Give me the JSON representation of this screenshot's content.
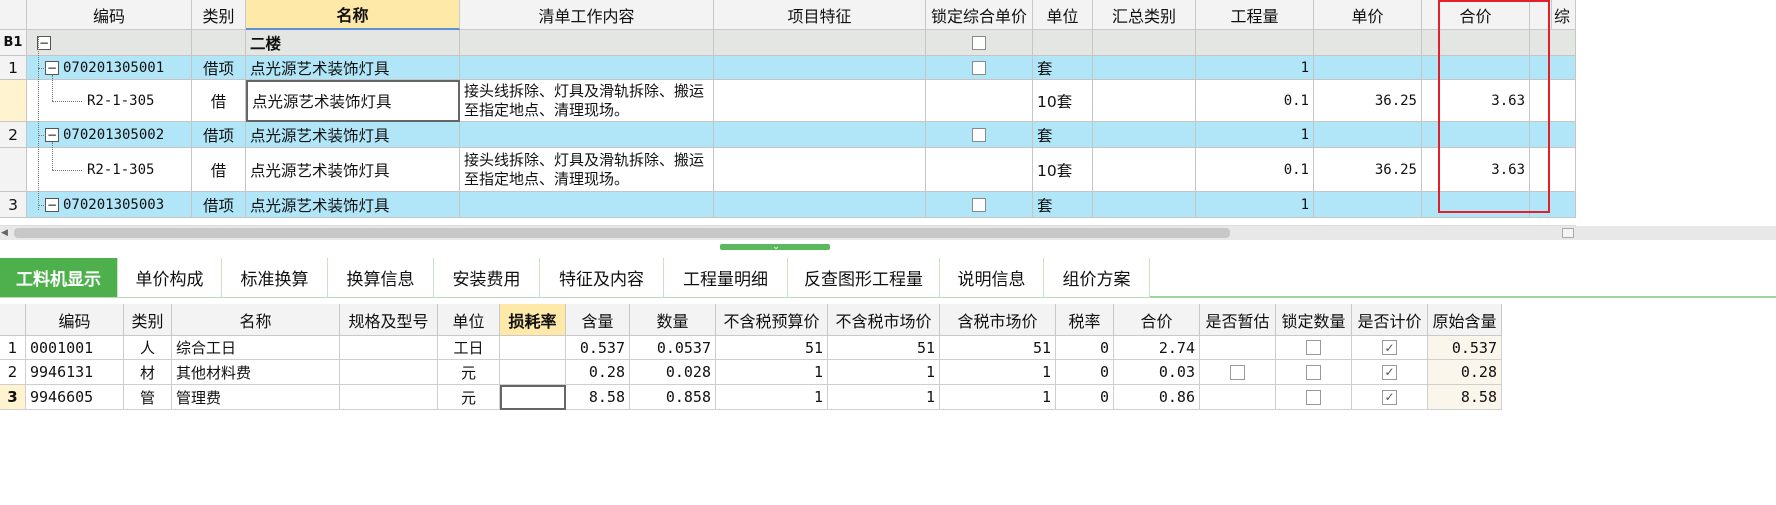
{
  "top_headers": [
    "编码",
    "类别",
    "名称",
    "清单工作内容",
    "项目特征",
    "锁定综合单价",
    "单位",
    "汇总类别",
    "工程量",
    "单价",
    "合价",
    "综"
  ],
  "top_rows": [
    {
      "num": "B1",
      "code": "",
      "type": "",
      "name": "二楼",
      "content": "",
      "feature": "",
      "unit": "",
      "qty": "",
      "price": "",
      "total": ""
    },
    {
      "num": "1",
      "code": "070201305001",
      "type": "借项",
      "name": "点光源艺术装饰灯具",
      "content": "",
      "feature": "",
      "unit": "套",
      "qty": "1",
      "price": "",
      "total": ""
    },
    {
      "num": "",
      "code": "R2-1-305",
      "type": "借",
      "name": "点光源艺术装饰灯具",
      "content": "接头线拆除、灯具及滑轨拆除、搬运至指定地点、清理现场。",
      "feature": "",
      "unit": "10套",
      "qty": "0.1",
      "price": "36.25",
      "total": "3.63"
    },
    {
      "num": "2",
      "code": "070201305002",
      "type": "借项",
      "name": "点光源艺术装饰灯具",
      "content": "",
      "feature": "",
      "unit": "套",
      "qty": "1",
      "price": "",
      "total": ""
    },
    {
      "num": "",
      "code": "R2-1-305",
      "type": "借",
      "name": "点光源艺术装饰灯具",
      "content": "接头线拆除、灯具及滑轨拆除、搬运至指定地点、清理现场。",
      "feature": "",
      "unit": "10套",
      "qty": "0.1",
      "price": "36.25",
      "total": "3.63"
    },
    {
      "num": "3",
      "code": "070201305003",
      "type": "借项",
      "name": "点光源艺术装饰灯具",
      "content": "",
      "feature": "",
      "unit": "套",
      "qty": "1",
      "price": "",
      "total": ""
    }
  ],
  "tabs": [
    "工料机显示",
    "单价构成",
    "标准换算",
    "换算信息",
    "安装费用",
    "特征及内容",
    "工程量明细",
    "反查图形工程量",
    "说明信息",
    "组价方案"
  ],
  "bottom_headers": [
    "编码",
    "类别",
    "名称",
    "规格及型号",
    "单位",
    "损耗率",
    "含量",
    "数量",
    "不含税预算价",
    "不含税市场价",
    "含税市场价",
    "税率",
    "合价",
    "是否暂估",
    "锁定数量",
    "是否计价",
    "原始含量"
  ],
  "bottom_rows": [
    {
      "num": "1",
      "code": "0001001",
      "type": "人",
      "name": "综合工日",
      "spec": "",
      "unit": "工日",
      "loss": "",
      "content": "0.537",
      "qty": "0.0537",
      "budget": "51",
      "market": "51",
      "taxmarket": "51",
      "tax": "0",
      "total": "2.74",
      "orig": "0.537"
    },
    {
      "num": "2",
      "code": "9946131",
      "type": "材",
      "name": "其他材料费",
      "spec": "",
      "unit": "元",
      "loss": "",
      "content": "0.28",
      "qty": "0.028",
      "budget": "1",
      "market": "1",
      "taxmarket": "1",
      "tax": "0",
      "total": "0.03",
      "orig": "0.28"
    },
    {
      "num": "3",
      "code": "9946605",
      "type": "管",
      "name": "管理费",
      "spec": "",
      "unit": "元",
      "loss": "",
      "content": "8.58",
      "qty": "0.858",
      "budget": "1",
      "market": "1",
      "taxmarket": "1",
      "tax": "0",
      "total": "0.86",
      "orig": "8.58"
    }
  ],
  "colors": {
    "highlight_box": "#e0202a",
    "active_tab": "#4db04d",
    "row_blue": "#b1e6f8"
  }
}
